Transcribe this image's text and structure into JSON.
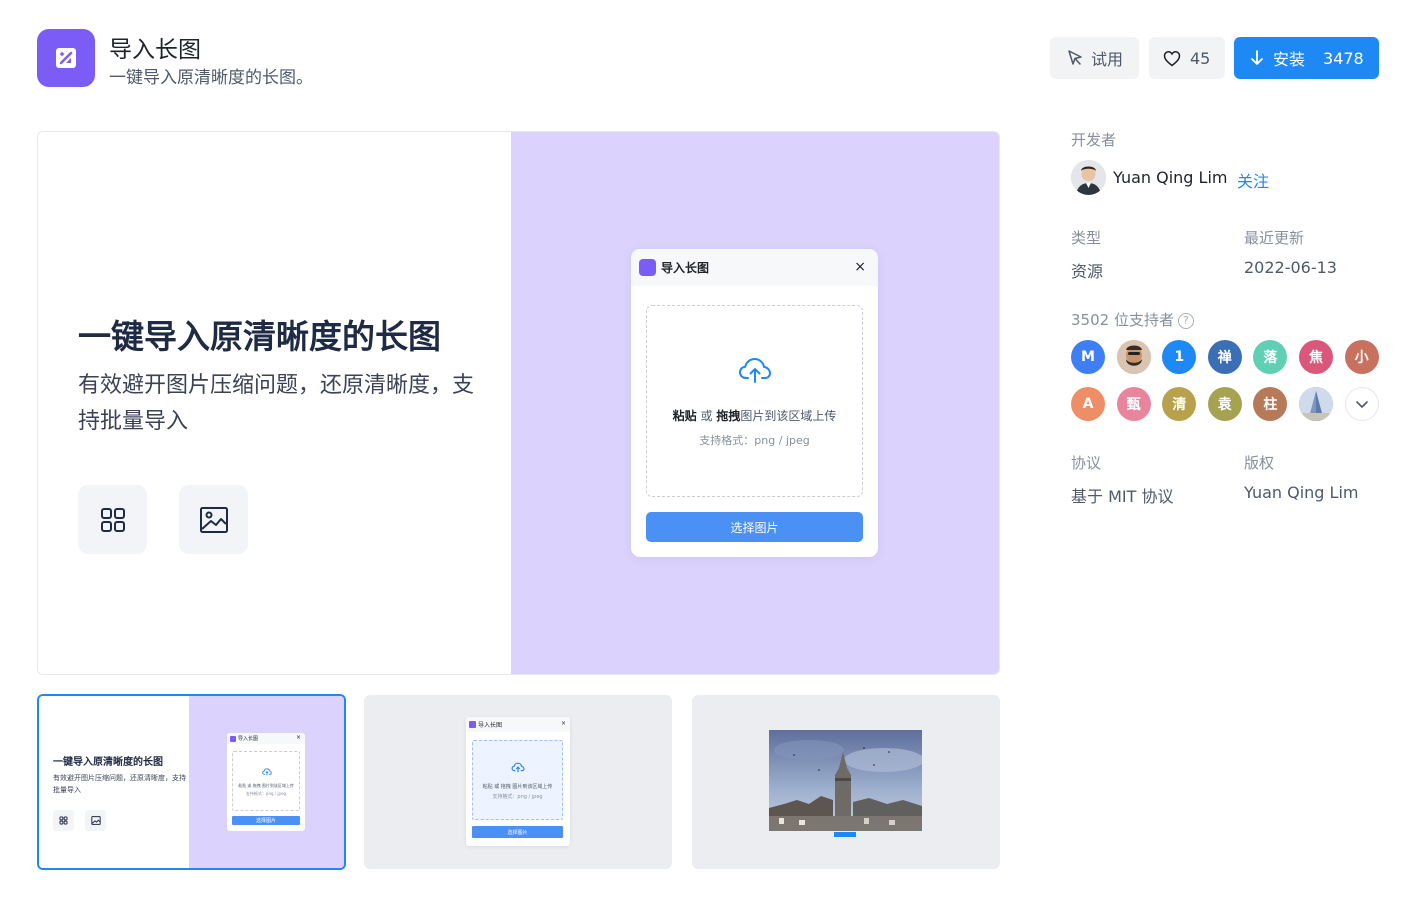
{
  "header": {
    "title": "导入长图",
    "subtitle": "一键导入原清晰度的长图。",
    "try_label": "试用",
    "like_count": "45",
    "install_label": "安装",
    "install_count": "3478"
  },
  "preview": {
    "hero_title": "一键导入原清晰度的长图",
    "hero_desc": "有效避开图片压缩问题，还原清晰度，支持批量导入",
    "dialog": {
      "title": "导入长图",
      "close": "×",
      "paste": "粘贴",
      "or": "或",
      "drag": "拖拽",
      "upload_hint": "图片到该区域上传",
      "format_hint": "支持格式：png / jpeg",
      "choose_button": "选择图片"
    }
  },
  "thumbnails": {
    "t1_title": "一键导入原清晰度的长图",
    "t1_desc": "有效避开图片压缩问题，还原清晰度，支持批量导入",
    "mini_title": "导入长图",
    "mini_paste_line": "粘贴 或 拖拽 图片到该区域上传",
    "mini_format": "支持格式：png / jpeg",
    "mini_button": "选择图片"
  },
  "sidebar": {
    "developer_label": "开发者",
    "developer_name": "Yuan Qing Lim",
    "follow_label": "关注",
    "type_label": "类型",
    "type_value": "资源",
    "updated_label": "最近更新",
    "updated_value": "2022-06-13",
    "supporters_label": "3502 位支持者",
    "help": "?",
    "license_label": "协议",
    "license_value": "基于 MIT 协议",
    "copyright_label": "版权",
    "copyright_value": "Yuan Qing Lim",
    "supporters": [
      {
        "text": "M",
        "color": "#3f7ef5"
      },
      {
        "text": "",
        "color": "#c9b8a6"
      },
      {
        "text": "1",
        "color": "#1e88f5"
      },
      {
        "text": "禅",
        "color": "#3b6fb5"
      },
      {
        "text": "落",
        "color": "#5fd0b3"
      },
      {
        "text": "焦",
        "color": "#d9577a"
      },
      {
        "text": "小",
        "color": "#c9715f"
      },
      {
        "text": "A",
        "color": "#ee8e67"
      },
      {
        "text": "甄",
        "color": "#e8859c"
      },
      {
        "text": "清",
        "color": "#b8a14c"
      },
      {
        "text": "袁",
        "color": "#a5a350"
      },
      {
        "text": "柱",
        "color": "#b77a59"
      },
      {
        "text": "",
        "color": "#8fa7cc"
      }
    ]
  },
  "colors": {
    "accent": "#1e88f5",
    "brand": "#7b5cf6",
    "preview_bg": "#dbd2fd"
  }
}
